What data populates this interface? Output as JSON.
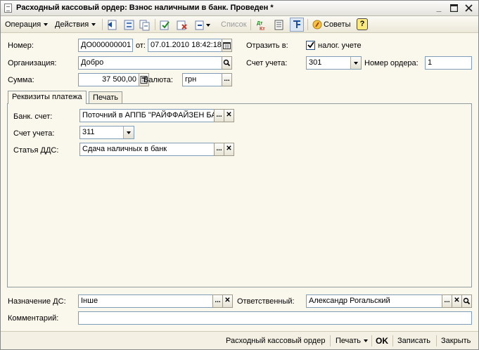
{
  "window": {
    "title": "Расходный кассовый ордер: Взнос наличными в банк. Проведен *"
  },
  "toolbar": {
    "operation_label": "Операция",
    "actions_label": "Действия",
    "list_label": "Список",
    "tips_label": "Советы",
    "help_label": "?"
  },
  "header": {
    "number_label": "Номер:",
    "number_value": "ДО000000001",
    "from_label": "от:",
    "date_value": "07.01.2010 18:42:18",
    "reflect_label": "Отразить в:",
    "tax_accounting_label": "налог. учете",
    "tax_accounting_checked": true,
    "org_label": "Организация:",
    "org_value": "Добро",
    "account_label": "Счет учета:",
    "account_value": "301",
    "order_number_label": "Номер ордера:",
    "order_number_value": "1",
    "sum_label": "Сумма:",
    "sum_value": "37 500,00",
    "currency_label": "Валюта:",
    "currency_value": "грн"
  },
  "tabs": [
    {
      "label": "Реквизиты платежа",
      "active": true
    },
    {
      "label": "Печать",
      "active": false
    }
  ],
  "payment": {
    "bank_account_label": "Банк. счет:",
    "bank_account_value": "Поточний в АППБ \"РАЙФФАЙЗЕН БАНК АВАЛЬ\"",
    "account_label": "Счет учета:",
    "account_value": "311",
    "dds_label": "Статья ДДС:",
    "dds_value": "Сдача наличных в банк"
  },
  "footer": {
    "purpose_label": "Назначение ДС:",
    "purpose_value": "Інше",
    "responsible_label": "Ответственный:",
    "responsible_value": "Александр Рогальский",
    "comment_label": "Комментарий:",
    "comment_value": ""
  },
  "bottombar": {
    "print_form_label": "Расходный кассовый ордер",
    "print_label": "Печать",
    "ok_label": "OK",
    "save_label": "Записать",
    "close_label": "Закрыть"
  },
  "colors": {
    "window_bg": "#faf7ec",
    "field_border": "#7f9db9",
    "accent_blue": "#1c4f9c"
  },
  "icons": [
    "document-icon",
    "minimize-icon",
    "maximize-icon",
    "close-icon",
    "calendar-icon",
    "calculator-icon",
    "search-icon",
    "clear-icon",
    "select-icon",
    "dropdown-icon",
    "checkmark-icon"
  ]
}
